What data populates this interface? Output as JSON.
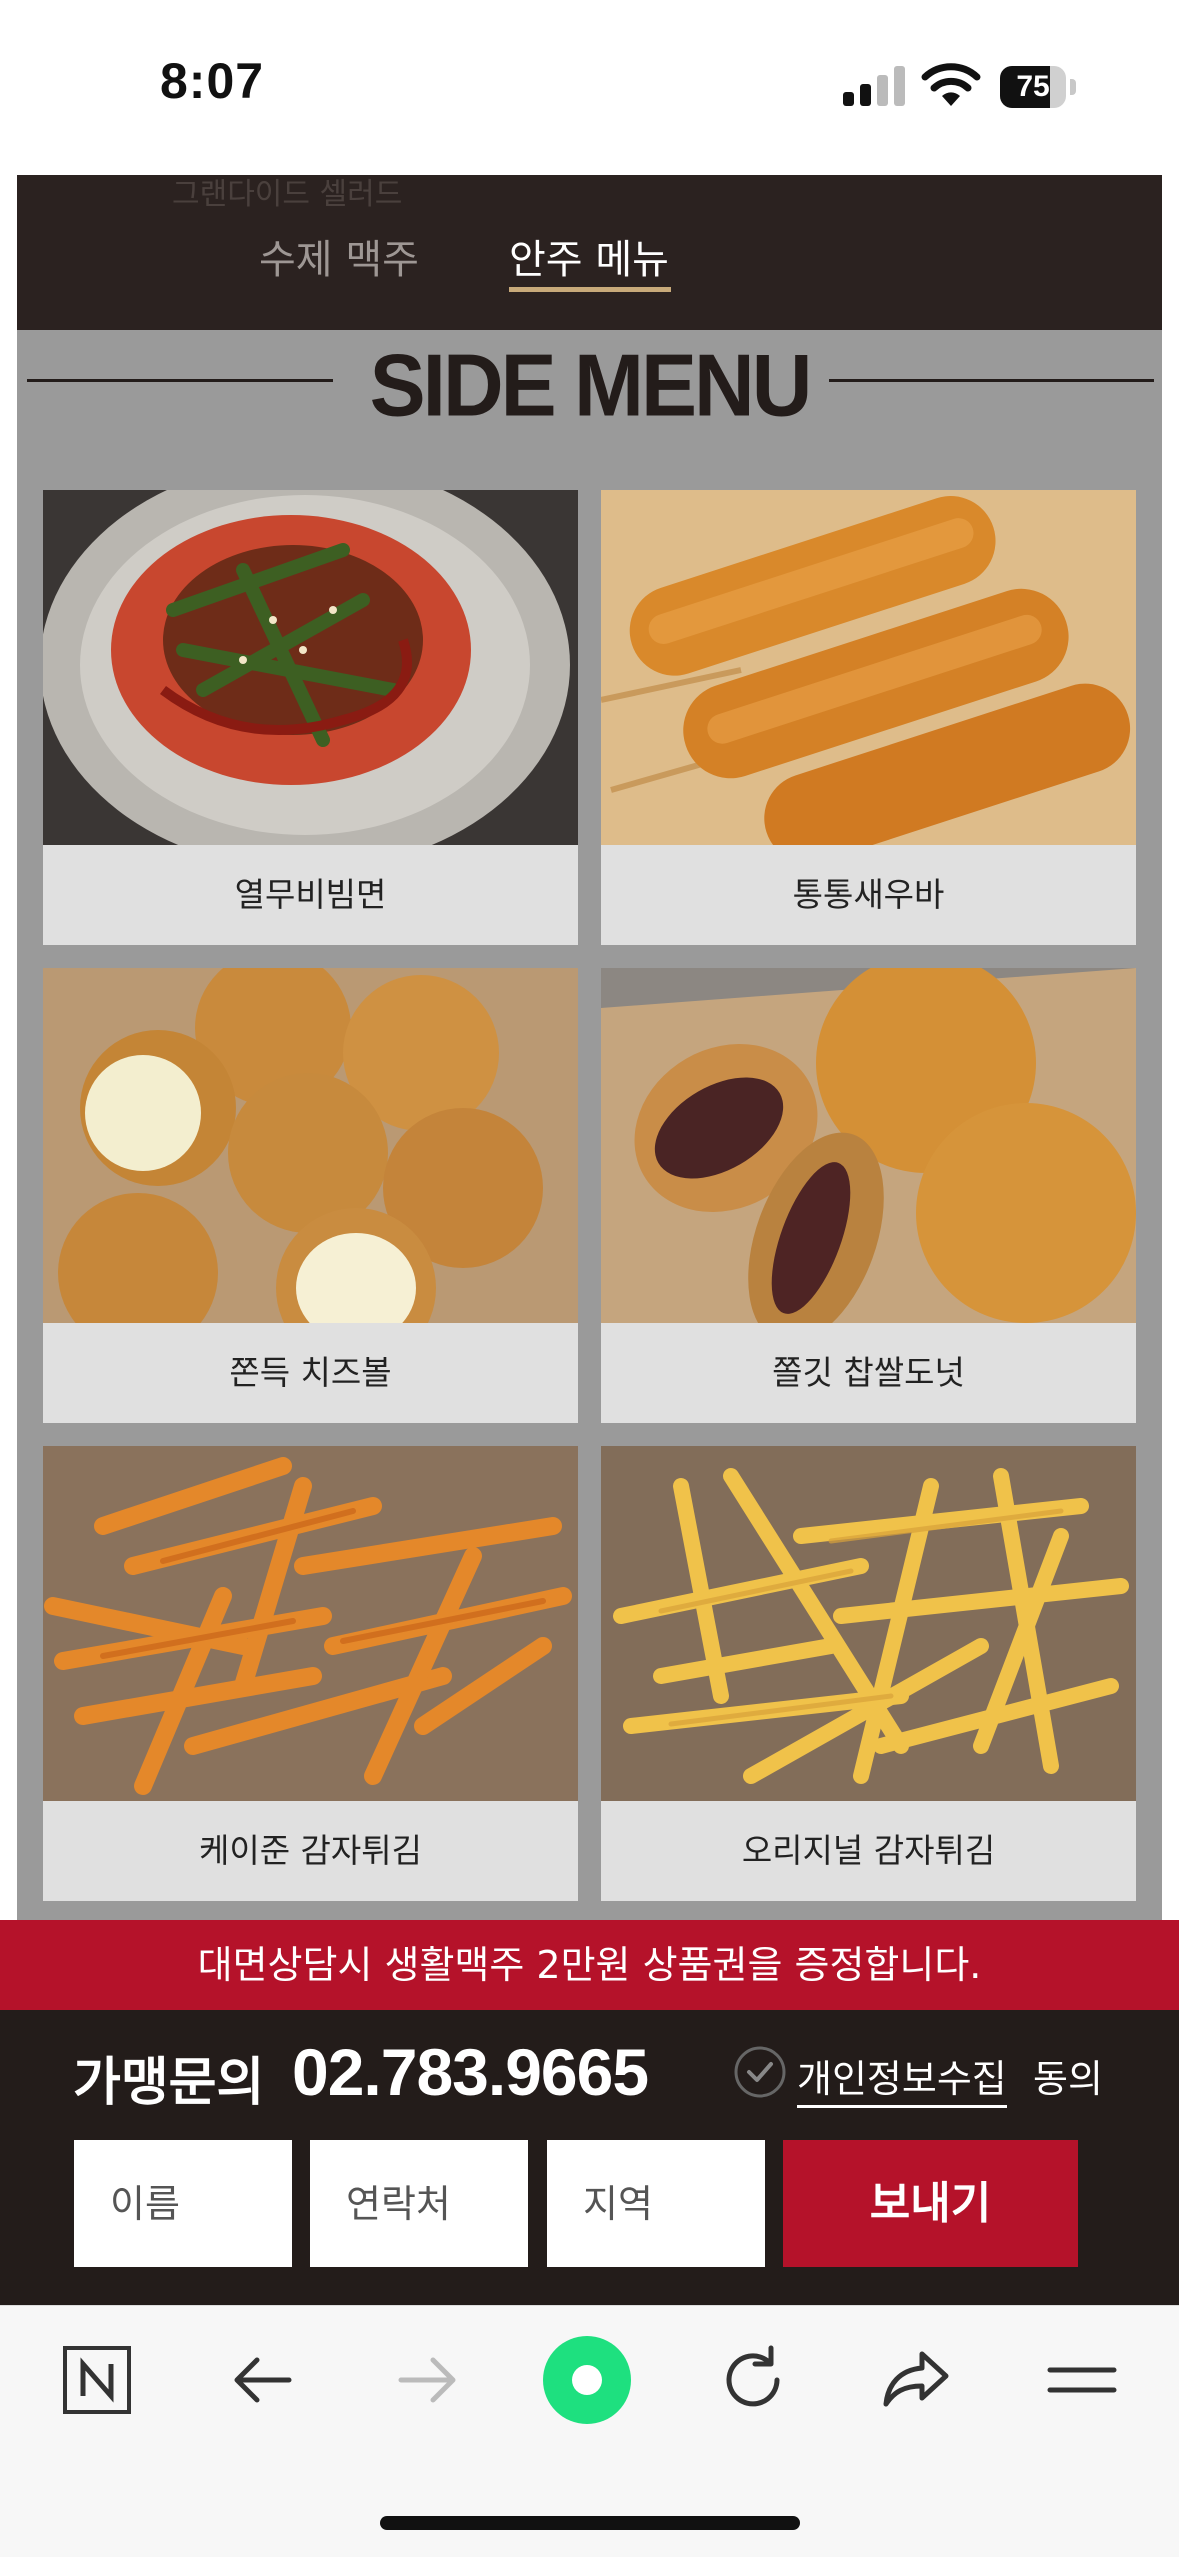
{
  "status_bar": {
    "time": "8:07",
    "battery": "75",
    "battery_level": 0.75
  },
  "tabs": {
    "ghost_text": "그랜다이드 셀러드",
    "beer": "수제 맥주",
    "snack": "안주 메뉴"
  },
  "section_title": "SIDE MENU",
  "menu_items": [
    {
      "label": "열무비빔면"
    },
    {
      "label": "통통새우바"
    },
    {
      "label": "쫀득 치즈볼"
    },
    {
      "label": "쫄깃 찹쌀도넛"
    },
    {
      "label": "케이준 감자튀김"
    },
    {
      "label": "오리지널 감자튀김"
    }
  ],
  "promo": "대면상담시 생활맥주 2만원 상품권을 증정합니다.",
  "contact": {
    "label": "가맹문의",
    "phone": "02.783.9665",
    "privacy_link": "개인정보수집",
    "privacy_agree": "동의",
    "name_placeholder": "이름",
    "phone_placeholder": "연락처",
    "region_placeholder": "지역",
    "send_label": "보내기"
  },
  "colors": {
    "accent_red": "#b5122a",
    "dark_brown": "#231c1a",
    "nav_green": "#1ee07f"
  },
  "toolbar_icons": [
    "naver-icon",
    "back-arrow-icon",
    "forward-arrow-icon",
    "green-dot-icon",
    "reload-icon",
    "share-icon",
    "menu-icon"
  ]
}
